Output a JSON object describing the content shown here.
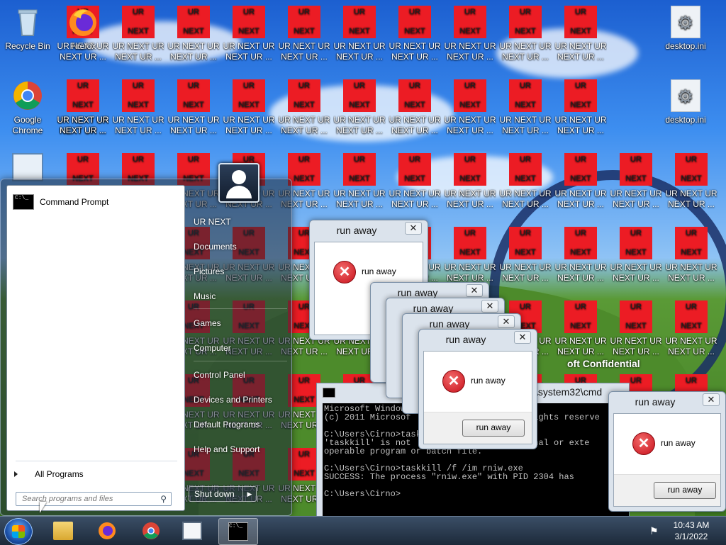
{
  "desktop": {
    "recycle_bin": "Recycle Bin",
    "firefox": "Firefox",
    "chrome_l1": "Google",
    "chrome_l2": "Chrome",
    "desktop_ini": "desktop.ini",
    "ur_top": "UR",
    "ur_bottom": "NEXT",
    "ur_label_l1": "UR NEXT UR",
    "ur_label_l2": "NEXT UR ..."
  },
  "start_menu": {
    "pinned_item": "Command Prompt",
    "all_programs": "All Programs",
    "search_placeholder": "Search programs and files",
    "right_items": [
      "UR NEXT",
      "Documents",
      "Pictures",
      "Music",
      "Games",
      "Computer",
      "Control Panel",
      "Devices and Printers",
      "Default Programs",
      "Help and Support"
    ],
    "shutdown": "Shut down"
  },
  "dialogs": {
    "title": "run away",
    "message": "run away",
    "button": "run away"
  },
  "console": {
    "title_partial": "\\system32\\cmd",
    "partial_text": "oft Confidential",
    "lines": "Microsoft Windows                         \n(c) 2011 Microsof                        ights reserve\n\nC:\\Users\\Cirno>task\n'taskkill' is not                      ernal or exte\noperable program or batch file.\n\nC:\\Users\\Cirno>taskkill /f /im rniw.exe\nSUCCESS: The process \"rniw.exe\" with PID 2304 has\n\nC:\\Users\\Cirno>"
  },
  "taskbar": {
    "time": "10:43 AM",
    "date": "3/1/2022"
  }
}
